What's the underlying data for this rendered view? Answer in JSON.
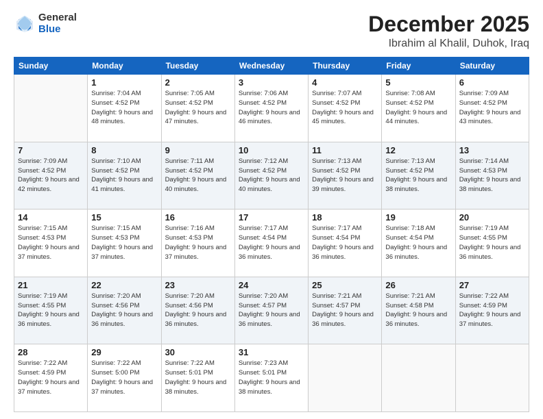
{
  "header": {
    "logo_general": "General",
    "logo_blue": "Blue",
    "month_title": "December 2025",
    "location": "Ibrahim al Khalil, Duhok, Iraq"
  },
  "days_of_week": [
    "Sunday",
    "Monday",
    "Tuesday",
    "Wednesday",
    "Thursday",
    "Friday",
    "Saturday"
  ],
  "weeks": [
    [
      {
        "day": null
      },
      {
        "day": 1,
        "sunrise": "7:04 AM",
        "sunset": "4:52 PM",
        "daylight": "9 hours and 48 minutes."
      },
      {
        "day": 2,
        "sunrise": "7:05 AM",
        "sunset": "4:52 PM",
        "daylight": "9 hours and 47 minutes."
      },
      {
        "day": 3,
        "sunrise": "7:06 AM",
        "sunset": "4:52 PM",
        "daylight": "9 hours and 46 minutes."
      },
      {
        "day": 4,
        "sunrise": "7:07 AM",
        "sunset": "4:52 PM",
        "daylight": "9 hours and 45 minutes."
      },
      {
        "day": 5,
        "sunrise": "7:08 AM",
        "sunset": "4:52 PM",
        "daylight": "9 hours and 44 minutes."
      },
      {
        "day": 6,
        "sunrise": "7:09 AM",
        "sunset": "4:52 PM",
        "daylight": "9 hours and 43 minutes."
      }
    ],
    [
      {
        "day": 7,
        "sunrise": "7:09 AM",
        "sunset": "4:52 PM",
        "daylight": "9 hours and 42 minutes."
      },
      {
        "day": 8,
        "sunrise": "7:10 AM",
        "sunset": "4:52 PM",
        "daylight": "9 hours and 41 minutes."
      },
      {
        "day": 9,
        "sunrise": "7:11 AM",
        "sunset": "4:52 PM",
        "daylight": "9 hours and 40 minutes."
      },
      {
        "day": 10,
        "sunrise": "7:12 AM",
        "sunset": "4:52 PM",
        "daylight": "9 hours and 40 minutes."
      },
      {
        "day": 11,
        "sunrise": "7:13 AM",
        "sunset": "4:52 PM",
        "daylight": "9 hours and 39 minutes."
      },
      {
        "day": 12,
        "sunrise": "7:13 AM",
        "sunset": "4:52 PM",
        "daylight": "9 hours and 38 minutes."
      },
      {
        "day": 13,
        "sunrise": "7:14 AM",
        "sunset": "4:53 PM",
        "daylight": "9 hours and 38 minutes."
      }
    ],
    [
      {
        "day": 14,
        "sunrise": "7:15 AM",
        "sunset": "4:53 PM",
        "daylight": "9 hours and 37 minutes."
      },
      {
        "day": 15,
        "sunrise": "7:15 AM",
        "sunset": "4:53 PM",
        "daylight": "9 hours and 37 minutes."
      },
      {
        "day": 16,
        "sunrise": "7:16 AM",
        "sunset": "4:53 PM",
        "daylight": "9 hours and 37 minutes."
      },
      {
        "day": 17,
        "sunrise": "7:17 AM",
        "sunset": "4:54 PM",
        "daylight": "9 hours and 36 minutes."
      },
      {
        "day": 18,
        "sunrise": "7:17 AM",
        "sunset": "4:54 PM",
        "daylight": "9 hours and 36 minutes."
      },
      {
        "day": 19,
        "sunrise": "7:18 AM",
        "sunset": "4:54 PM",
        "daylight": "9 hours and 36 minutes."
      },
      {
        "day": 20,
        "sunrise": "7:19 AM",
        "sunset": "4:55 PM",
        "daylight": "9 hours and 36 minutes."
      }
    ],
    [
      {
        "day": 21,
        "sunrise": "7:19 AM",
        "sunset": "4:55 PM",
        "daylight": "9 hours and 36 minutes."
      },
      {
        "day": 22,
        "sunrise": "7:20 AM",
        "sunset": "4:56 PM",
        "daylight": "9 hours and 36 minutes."
      },
      {
        "day": 23,
        "sunrise": "7:20 AM",
        "sunset": "4:56 PM",
        "daylight": "9 hours and 36 minutes."
      },
      {
        "day": 24,
        "sunrise": "7:20 AM",
        "sunset": "4:57 PM",
        "daylight": "9 hours and 36 minutes."
      },
      {
        "day": 25,
        "sunrise": "7:21 AM",
        "sunset": "4:57 PM",
        "daylight": "9 hours and 36 minutes."
      },
      {
        "day": 26,
        "sunrise": "7:21 AM",
        "sunset": "4:58 PM",
        "daylight": "9 hours and 36 minutes."
      },
      {
        "day": 27,
        "sunrise": "7:22 AM",
        "sunset": "4:59 PM",
        "daylight": "9 hours and 37 minutes."
      }
    ],
    [
      {
        "day": 28,
        "sunrise": "7:22 AM",
        "sunset": "4:59 PM",
        "daylight": "9 hours and 37 minutes."
      },
      {
        "day": 29,
        "sunrise": "7:22 AM",
        "sunset": "5:00 PM",
        "daylight": "9 hours and 37 minutes."
      },
      {
        "day": 30,
        "sunrise": "7:22 AM",
        "sunset": "5:01 PM",
        "daylight": "9 hours and 38 minutes."
      },
      {
        "day": 31,
        "sunrise": "7:23 AM",
        "sunset": "5:01 PM",
        "daylight": "9 hours and 38 minutes."
      },
      {
        "day": null
      },
      {
        "day": null
      },
      {
        "day": null
      }
    ]
  ],
  "labels": {
    "sunrise": "Sunrise:",
    "sunset": "Sunset:",
    "daylight": "Daylight:"
  }
}
